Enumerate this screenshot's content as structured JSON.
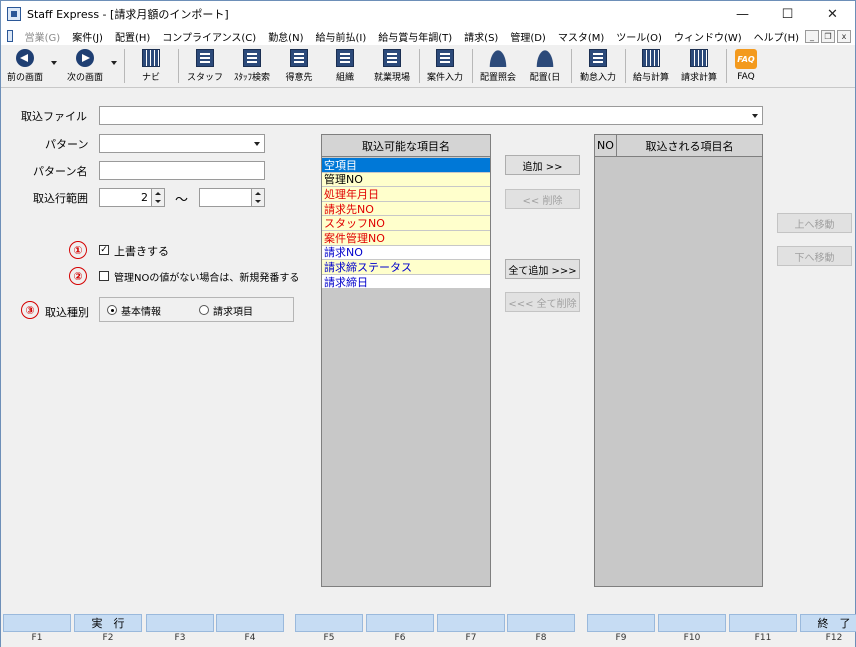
{
  "window": {
    "title": "Staff Express - [請求月額のインポート]"
  },
  "window_controls": {
    "minimize": "—",
    "maximize": "☐",
    "close": "✕"
  },
  "menubar": {
    "items": [
      "営業(G)",
      "案件(J)",
      "配置(H)",
      "コンプライアンス(C)",
      "勤怠(N)",
      "給与前払(I)",
      "給与賞与年調(T)",
      "請求(S)",
      "管理(D)",
      "マスタ(M)",
      "ツール(O)",
      "ウィンドウ(W)",
      "ヘルプ(H)"
    ],
    "mdi": {
      "minimize": "_",
      "restore": "❐",
      "close": "x"
    }
  },
  "toolbar": {
    "prev": "前の画面",
    "next": "次の画面",
    "navi": "ナビ",
    "staff": "スタッフ",
    "staff_search": "ｽﾀｯﾌ検索",
    "client": "得意先",
    "organization": "組織",
    "workplace": "就業現場",
    "case_entry": "案件入力",
    "assignment_inquiry": "配置照会",
    "assignment_day": "配置(日",
    "attendance_entry": "勤怠入力",
    "payroll_calc": "給与計算",
    "billing_calc": "請求計算",
    "faq": "FAQ",
    "faq_icon_text": "FAQ"
  },
  "form": {
    "import_file_label": "取込ファイル",
    "import_file_value": "",
    "pattern_label": "パターン",
    "pattern_value": "",
    "pattern_name_label": "パターン名",
    "pattern_name_value": "",
    "range_label": "取込行範囲",
    "range_from": "2",
    "range_tilde": "～",
    "range_to": ""
  },
  "options": {
    "marker1": "①",
    "marker2": "②",
    "marker3": "③",
    "overwrite_label": "上書きする",
    "overwrite_checked": true,
    "overwrite_check_glyph": "✓",
    "new_number_label": "管理NOの値がない場合は、新規発番する",
    "new_number_checked": false,
    "import_type_label": "取込種別",
    "import_type_basic": "基本情報",
    "import_type_billing": "請求項目",
    "import_type_selected": "基本情報"
  },
  "available_items": {
    "header": "取込可能な項目名",
    "rows": [
      {
        "label": "空項目",
        "color": "#ffffff",
        "bg": "#0078d7"
      },
      {
        "label": "管理NO",
        "color": "#000000",
        "bg": "#ffffcc"
      },
      {
        "label": "処理年月日",
        "color": "#e00000",
        "bg": "#ffffcc"
      },
      {
        "label": "請求先NO",
        "color": "#e00000",
        "bg": "#ffffcc"
      },
      {
        "label": "スタッフNO",
        "color": "#e00000",
        "bg": "#ffffcc"
      },
      {
        "label": "案件管理NO",
        "color": "#e00000",
        "bg": "#ffffcc"
      },
      {
        "label": "請求NO",
        "color": "#0000cc",
        "bg": "#ffffff"
      },
      {
        "label": "請求締ステータス",
        "color": "#0000cc",
        "bg": "#ffffcc"
      },
      {
        "label": "請求締日",
        "color": "#0000cc",
        "bg": "#ffffff"
      }
    ]
  },
  "imported_items": {
    "no_header": "NO",
    "header": "取込される項目名"
  },
  "buttons": {
    "add": "追加 >>",
    "remove": "<< 削除",
    "add_all": "全て追加 >>>",
    "remove_all": "<<< 全て削除",
    "move_up": "上へ移動",
    "move_down": "下へ移動"
  },
  "fkeys": [
    {
      "key": "F1",
      "label": ""
    },
    {
      "key": "F2",
      "label": "実　行"
    },
    {
      "key": "F3",
      "label": ""
    },
    {
      "key": "F4",
      "label": ""
    },
    {
      "key": "F5",
      "label": ""
    },
    {
      "key": "F6",
      "label": ""
    },
    {
      "key": "F7",
      "label": ""
    },
    {
      "key": "F8",
      "label": ""
    },
    {
      "key": "F9",
      "label": ""
    },
    {
      "key": "F10",
      "label": ""
    },
    {
      "key": "F11",
      "label": ""
    },
    {
      "key": "F12",
      "label": "終　了"
    }
  ]
}
